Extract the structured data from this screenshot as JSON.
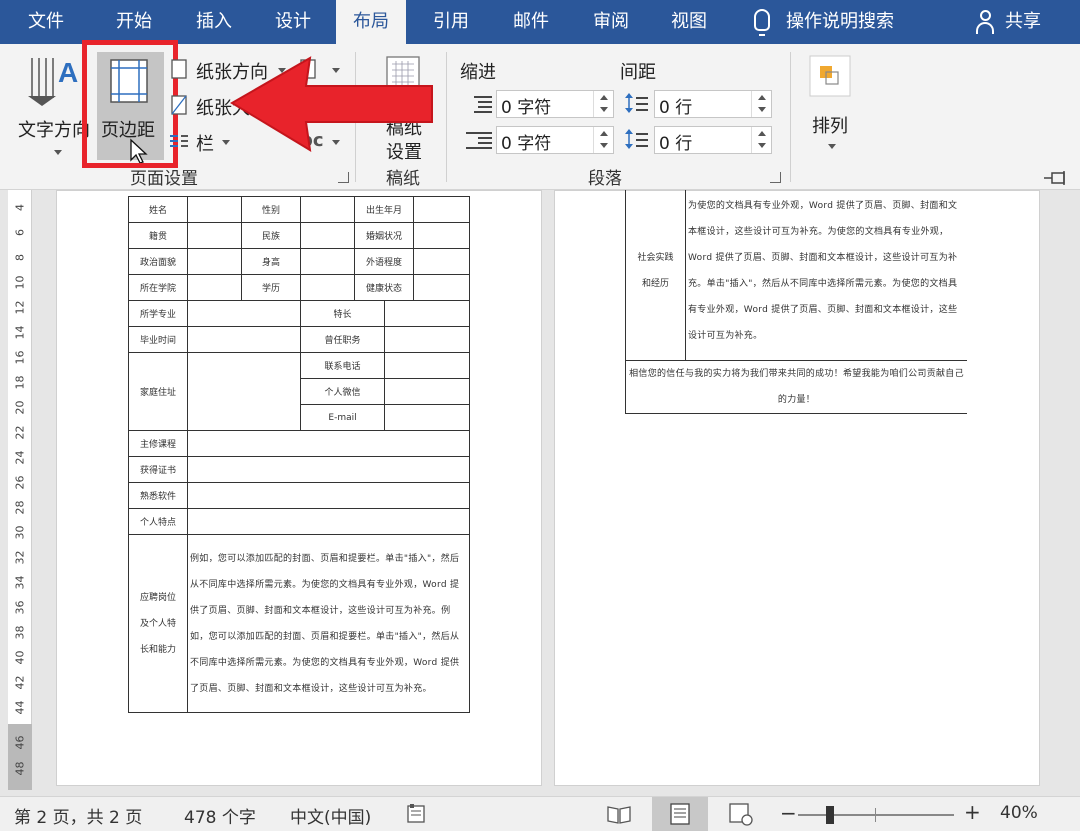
{
  "tabs": [
    "文件",
    "开始",
    "插入",
    "设计",
    "布局",
    "引用",
    "邮件",
    "审阅",
    "视图"
  ],
  "tell_me": "操作说明搜索",
  "share": "共享",
  "ribbon": {
    "text_direction": "文字方向",
    "margins": "页边距",
    "orientation": "纸张方向",
    "size": "纸张大",
    "columns": "栏",
    "breaks_partial": "bc",
    "page_setup_group": "页面设置",
    "draft_paper_line1": "稿纸",
    "draft_paper_line2": "设置",
    "draft_paper_group": "稿纸",
    "indent_label": "缩进",
    "spacing_label": "间距",
    "indent_left": "0 字符",
    "indent_right": "0 字符",
    "spacing_before": "0 行",
    "spacing_after": "0 行",
    "paragraph_group": "段落",
    "arrange": "排列"
  },
  "ruler_numbers": [
    "4",
    "6",
    "8",
    "10",
    "12",
    "14",
    "16",
    "18",
    "20",
    "22",
    "24",
    "26",
    "28",
    "30",
    "32",
    "34",
    "36",
    "38",
    "40",
    "42",
    "44",
    "46",
    "48"
  ],
  "form": {
    "name": "姓名",
    "gender": "性别",
    "birth": "出生年月",
    "native": "籍贯",
    "ethnic": "民族",
    "marital": "婚姻状况",
    "political": "政治面貌",
    "height": "身高",
    "foreign_lang": "外语程度",
    "school": "所在学院",
    "education": "学历",
    "health": "健康状态",
    "major": "所学专业",
    "specialty": "特长",
    "graduation": "毕业时间",
    "position_held": "曾任职务",
    "phone": "联系电话",
    "address": "家庭住址",
    "wechat": "个人微信",
    "email": "E-mail",
    "courses": "主修课程",
    "certificates": "获得证书",
    "software": "熟悉软件",
    "traits": "个人特点",
    "apply_l1": "应聘岗位",
    "apply_l2": "及个人特",
    "apply_l3": "长和能力",
    "apply_text": "例如，您可以添加匹配的封面、页眉和提要栏。单击\"插入\"，然后从不同库中选择所需元素。为使您的文档具有专业外观，Word 提供了页眉、页脚、封面和文本框设计，这些设计可互为补充。例如，您可以添加匹配的封面、页眉和提要栏。单击\"插入\"，然后从不同库中选择所需元素。为使您的文档具有专业外观，Word 提供了页眉、页脚、封面和文本框设计，这些设计可互为补充。"
  },
  "page2": {
    "practice_l1": "社会实践",
    "practice_l2": "和经历",
    "practice_text": "为使您的文档具有专业外观，Word 提供了页眉、页脚、封面和文本框设计，这些设计可互为补充。为使您的文档具有专业外观，Word 提供了页眉、页脚、封面和文本框设计，这些设计可互为补充。单击\"插入\"，然后从不同库中选择所需元素。为使您的文档具有专业外观，Word 提供了页眉、页脚、封面和文本框设计，这些设计可互为补充。",
    "closing": "相信您的信任与我的实力将为我们带来共同的成功！希望我能为咱们公司贡献自己的力量！"
  },
  "status": {
    "page": "第 2 页，共 2 页",
    "words": "478 个字",
    "language": "中文(中国)",
    "zoom_minus": "−",
    "zoom_plus": "+",
    "zoom": "40%"
  },
  "colors": {
    "tabbar": "#2b579a",
    "ribbon": "#f3f3f3",
    "highlight": "#e8232b"
  }
}
